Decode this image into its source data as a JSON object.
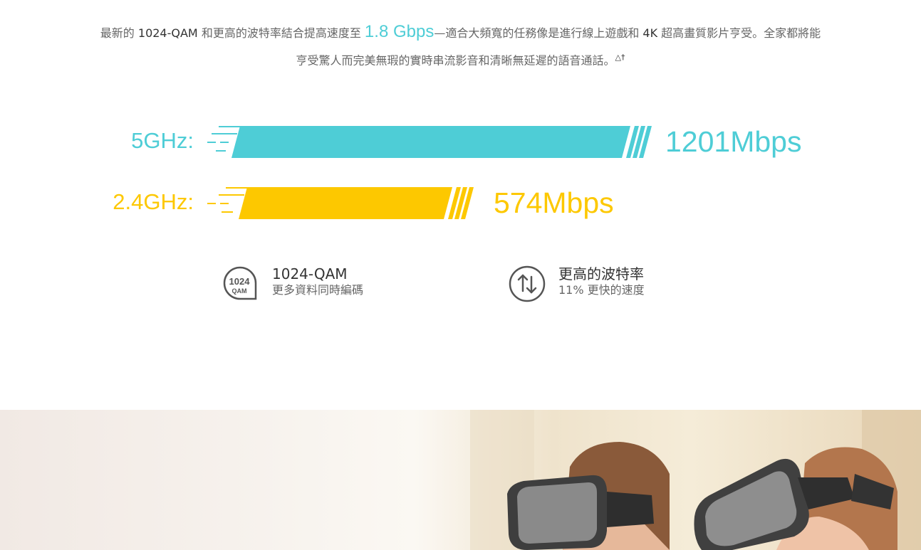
{
  "intro": {
    "p1": "最新的 ",
    "p2": "1024-QAM",
    "p3": " 和更高的波特率結合提高速度至 ",
    "highlight": "1.8 Gbps",
    "p4": "—適合大頻寬的任務像是進行線上遊戲和 ",
    "p5": "4K",
    "p6": " 超高畫質影片亨受。全家都將能亨受驚人而完美無瑕的實時串流影音和清晰無延遲的語音通話。",
    "sup": "△†"
  },
  "bands": [
    {
      "label": "5GHz:",
      "speed": "1201Mbps",
      "color": "#4ecdd6",
      "mbps": 1201
    },
    {
      "label": "2.4GHz:",
      "speed": "574Mbps",
      "color": "#fdc800",
      "mbps": 574
    }
  ],
  "features": [
    {
      "icon": "qam-1024-icon",
      "icon_line1": "1024",
      "icon_line2": "QAM",
      "title": "1024-QAM",
      "subtitle": "更多資料同時編碼"
    },
    {
      "icon": "up-down-arrows-icon",
      "title": "更高的波特率",
      "subtitle": "11% 更快的速度"
    }
  ]
}
